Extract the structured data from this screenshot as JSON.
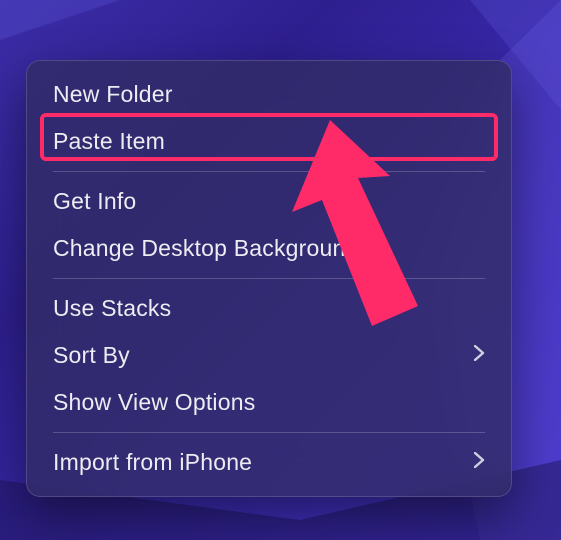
{
  "menu": {
    "new_folder": "New Folder",
    "paste_item": "Paste Item",
    "get_info": "Get Info",
    "change_bg": "Change Desktop Background…",
    "use_stacks": "Use Stacks",
    "sort_by": "Sort By",
    "show_view_options": "Show View Options",
    "import_from_iphone": "Import from iPhone"
  },
  "annotation": {
    "highlight_color": "#ff2a68"
  }
}
